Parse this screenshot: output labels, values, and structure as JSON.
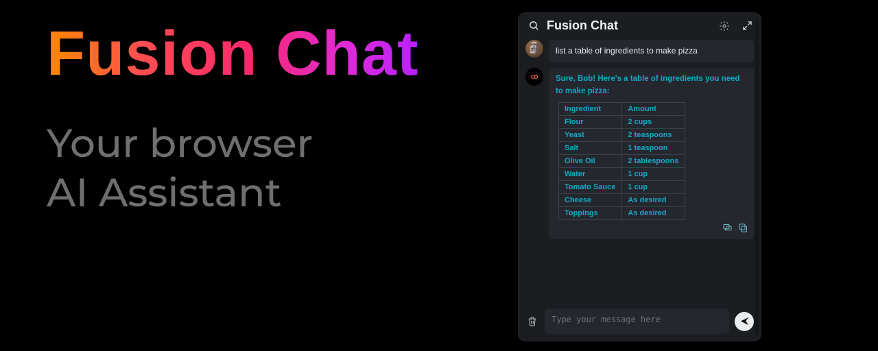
{
  "marketing": {
    "title": "Fusion Chat",
    "subtitle_line1": "Your browser",
    "subtitle_line2": "AI Assistant"
  },
  "panel": {
    "title": "Fusion Chat"
  },
  "conversation": {
    "user_message": "list a table of ingredients to make pizza",
    "bot_intro": "Sure, Bob! Here's a table of ingredients you need to make pizza:",
    "table_headers": {
      "ingredient": "Ingredient",
      "amount": "Amount"
    },
    "ingredients": [
      {
        "ingredient": "Flour",
        "amount": "2 cups"
      },
      {
        "ingredient": "Yeast",
        "amount": "2 teaspoons"
      },
      {
        "ingredient": "Salt",
        "amount": "1 teaspoon"
      },
      {
        "ingredient": "Olive Oil",
        "amount": "2 tablespoons"
      },
      {
        "ingredient": "Water",
        "amount": "1 cup"
      },
      {
        "ingredient": "Tomato Sauce",
        "amount": "1 cup"
      },
      {
        "ingredient": "Cheese",
        "amount": "As desired"
      },
      {
        "ingredient": "Toppings",
        "amount": "As desired"
      }
    ]
  },
  "input": {
    "placeholder": "Type your message here"
  },
  "colors": {
    "panel_bg": "#1b1d21",
    "bubble_bg": "#24272d",
    "accent_teal": "#13a9c7"
  }
}
